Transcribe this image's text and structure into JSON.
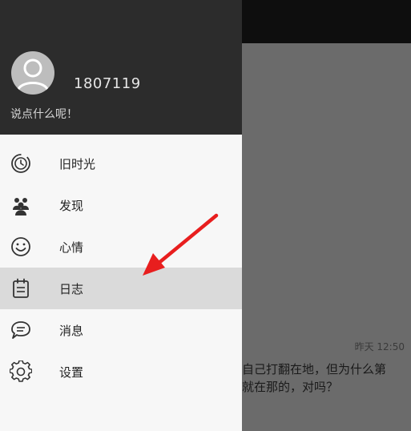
{
  "background": {
    "timestamp": "昨天 12:50",
    "text_line1": "自己打翻在地，但为什么第",
    "text_line2": "就在那的，对吗？"
  },
  "drawer": {
    "username": "1807119",
    "signature": "说点什么呢！",
    "menu": [
      {
        "label": "旧时光",
        "icon": "time-machine-icon"
      },
      {
        "label": "发现",
        "icon": "people-group-icon"
      },
      {
        "label": "心情",
        "icon": "smiley-icon"
      },
      {
        "label": "日志",
        "icon": "clipboard-icon",
        "active": true
      },
      {
        "label": "消息",
        "icon": "chat-bubble-icon"
      },
      {
        "label": "设置",
        "icon": "gear-icon"
      }
    ]
  },
  "colors": {
    "header_bg": "#2c2c2c",
    "drawer_bg": "#f7f7f7",
    "active_item_bg": "#dadada",
    "annotation_arrow": "#e81e1e"
  }
}
